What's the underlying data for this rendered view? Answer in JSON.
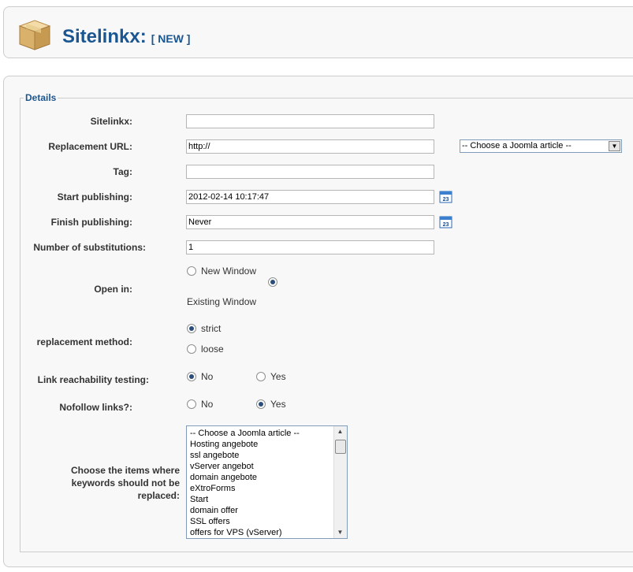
{
  "header": {
    "title": "Sitelinkx:",
    "tag": "[ NEW ]"
  },
  "fieldset": {
    "legend": "Details"
  },
  "fields": {
    "sitelinkx": {
      "label": "Sitelinkx:",
      "value": ""
    },
    "replacement_url": {
      "label": "Replacement URL:",
      "value": "http://"
    },
    "article_select": {
      "selected": "-- Choose a Joomla article --"
    },
    "tag": {
      "label": "Tag:",
      "value": ""
    },
    "start_publishing": {
      "label": "Start publishing:",
      "value": "2012-02-14 10:17:47"
    },
    "finish_publishing": {
      "label": "Finish publishing:",
      "value": "Never"
    },
    "substitutions": {
      "label": "Number of substitutions:",
      "value": "1"
    },
    "open_in": {
      "label": "Open in:",
      "options": [
        "New Window",
        "Existing Window"
      ],
      "selected": "Existing Window"
    },
    "replacement_method": {
      "label": "replacement method:",
      "options": [
        "strict",
        "loose"
      ],
      "selected": "strict"
    },
    "reachability": {
      "label": "Link reachability testing:",
      "options": [
        "No",
        "Yes"
      ],
      "selected": "No"
    },
    "nofollow": {
      "label": "Nofollow links?:",
      "options": [
        "No",
        "Yes"
      ],
      "selected": "Yes"
    },
    "exclude_items": {
      "label_lines": [
        "Choose the items where",
        "keywords should not be",
        "replaced:"
      ],
      "items": [
        "-- Choose a Joomla article --",
        "Hosting angebote",
        "ssl angebote",
        "vServer angebot",
        "domain angebote",
        "eXtroForms",
        "Start",
        "domain offer",
        "SSL offers",
        "offers for VPS (vServer)"
      ]
    }
  }
}
